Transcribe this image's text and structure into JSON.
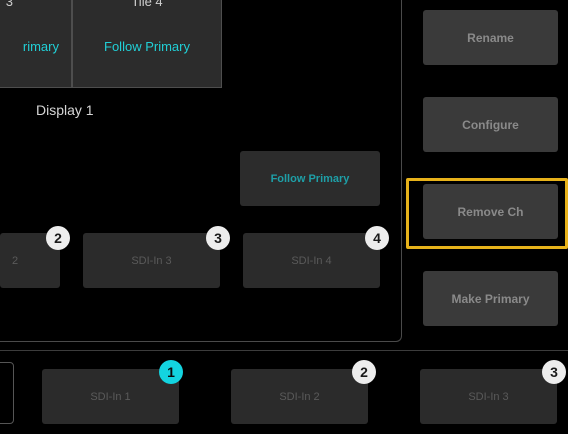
{
  "tiles": [
    {
      "title": "3",
      "source": "rimary"
    },
    {
      "title": "Tile 4",
      "source": "Follow Primary"
    }
  ],
  "display_label": "Display 1",
  "follow_primary_button": "Follow Primary",
  "input_buttons": [
    {
      "label": "2",
      "badge": "2"
    },
    {
      "label": "SDI-In 3",
      "badge": "3"
    },
    {
      "label": "SDI-In 4",
      "badge": "4"
    }
  ],
  "side_buttons": {
    "rename": "Rename",
    "configure": "Configure",
    "remove_ch": "Remove Ch",
    "make_primary": "Make Primary"
  },
  "bottom_sources": [
    {
      "label": "SDI-In 1",
      "badge": "1",
      "badge_color": "#13d4e0"
    },
    {
      "label": "SDI-In 2",
      "badge": "2",
      "badge_color": "#ededed"
    },
    {
      "label": "SDI-In 3",
      "badge": "3",
      "badge_color": "#ededed"
    }
  ],
  "colors": {
    "accent": "#21cfd6",
    "highlight": "#e7b21a",
    "button_bg": "#2b2b2b"
  }
}
